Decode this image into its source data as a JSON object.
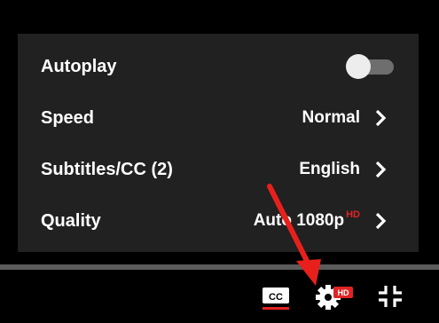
{
  "settings": {
    "autoplay": {
      "label": "Autoplay",
      "enabled": false
    },
    "speed": {
      "label": "Speed",
      "value": "Normal"
    },
    "subtitles": {
      "label": "Subtitles/CC (2)",
      "value": "English"
    },
    "quality": {
      "label": "Quality",
      "value": "Auto 1080p",
      "badge": "HD"
    }
  },
  "controls": {
    "cc_label": "CC",
    "settings_badge": "HD"
  },
  "colors": {
    "panel": "#212121",
    "accent_red": "#e02424",
    "annotation_arrow": "#e8201c"
  },
  "icons": [
    "chevron-right-icon",
    "subtitles-icon",
    "settings-gear-icon",
    "exit-fullscreen-icon",
    "annotation-arrow-icon"
  ]
}
